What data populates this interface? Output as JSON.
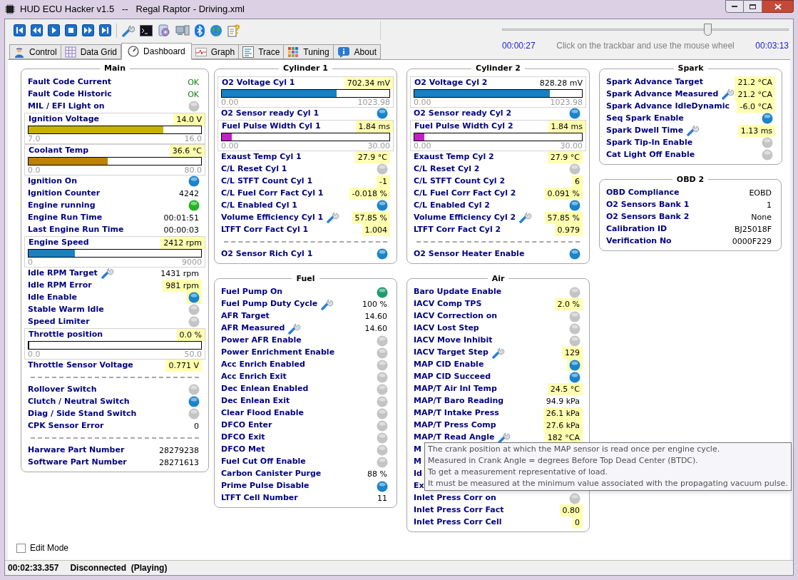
{
  "window": {
    "title": "HUD ECU Hacker v1.5   --   Regal Raptor - Driving.xml"
  },
  "playback": {
    "start": "00:00:27",
    "hint": "Click on the trackbar and use the mouse wheel",
    "end": "00:03:13",
    "level": 0.717
  },
  "tabs": [
    {
      "label": "Control",
      "selected": false
    },
    {
      "label": "Data Grid",
      "selected": false
    },
    {
      "label": "Dashboard",
      "selected": true
    },
    {
      "label": "Graph",
      "selected": false
    },
    {
      "label": "Trace",
      "selected": false
    },
    {
      "label": "Tuning",
      "selected": false
    },
    {
      "label": "About",
      "selected": false
    }
  ],
  "columns": [
    [
      {
        "title": "Main",
        "rows": [
          {
            "kind": "value",
            "label": "Fault Code Current",
            "value": "OK",
            "highlighted": false,
            "color": "#108010"
          },
          {
            "kind": "value",
            "label": "Fault Code Historic",
            "value": "OK",
            "highlighted": false,
            "color": "#108010"
          },
          {
            "kind": "led",
            "label": "MIL / EFI Light on",
            "color": "#c4c4c4",
            "highlighted": false
          },
          {
            "kind": "gauge",
            "label": "Ignition Voltage",
            "value": "14.0 V",
            "highlighted": true,
            "level": 0.78,
            "min": "7.0",
            "max": "16.0",
            "color": "#c8b000"
          },
          {
            "kind": "gauge",
            "label": "Coolant Temp",
            "value": "36.6 °C",
            "highlighted": true,
            "level": 0.46,
            "min": "0.0",
            "max": "80.0",
            "color": "#c08000"
          },
          {
            "kind": "led",
            "label": "Ignition On",
            "color": "#1a84c8",
            "highlighted": false
          },
          {
            "kind": "value",
            "label": "Ignition Counter",
            "value": "4242",
            "highlighted": false
          },
          {
            "kind": "led",
            "label": "Engine running",
            "color": "#22b422",
            "highlighted": false
          },
          {
            "kind": "value",
            "label": "Engine Run Time",
            "value": "00:01:51",
            "highlighted": false
          },
          {
            "kind": "value",
            "label": "Last Engine Run Time",
            "value": "00:00:03",
            "highlighted": false
          },
          {
            "kind": "gauge",
            "label": "Engine Speed",
            "value": "2412 rpm",
            "highlighted": true,
            "level": 0.27,
            "min": "0",
            "max": "9000",
            "color": "#1a80c0"
          },
          {
            "kind": "value",
            "label": "Idle RPM Target",
            "value": "1431 rpm",
            "highlighted": false,
            "wrench": true
          },
          {
            "kind": "value",
            "label": "Idle RPM Error",
            "value": "981 rpm",
            "highlighted": true
          },
          {
            "kind": "led",
            "label": "Idle Enable",
            "color": "#1a84c8",
            "highlighted": true
          },
          {
            "kind": "led",
            "label": "Stable Warm Idle",
            "color": "#c4c4c4",
            "highlighted": false
          },
          {
            "kind": "led",
            "label": "Speed Limiter",
            "color": "#c4c4c4",
            "highlighted": false
          },
          {
            "kind": "gauge",
            "label": "Throttle position",
            "value": "0.0 %",
            "highlighted": true,
            "level": 0,
            "min": "0.0",
            "max": "50.0"
          },
          {
            "kind": "value",
            "label": "Throttle Sensor Voltage",
            "value": "0.771 V",
            "highlighted": true
          },
          {
            "kind": "separator"
          },
          {
            "kind": "led",
            "label": "Rollover Switch",
            "color": "#c4c4c4",
            "highlighted": false
          },
          {
            "kind": "led",
            "label": "Clutch / Neutral Switch",
            "color": "#1a84c8",
            "highlighted": false
          },
          {
            "kind": "led",
            "label": "Diag / Side Stand Switch",
            "color": "#c4c4c4",
            "highlighted": false
          },
          {
            "kind": "value",
            "label": "CPK Sensor Error",
            "value": "0",
            "highlighted": false
          },
          {
            "kind": "separator"
          },
          {
            "kind": "value",
            "label": "Harware Part Number",
            "value": "28279238",
            "highlighted": false
          },
          {
            "kind": "value",
            "label": "Software Part Number",
            "value": "28271613",
            "highlighted": false
          }
        ]
      }
    ],
    [
      {
        "title": "Cylinder 1",
        "rows": [
          {
            "kind": "gauge",
            "label": "O2 Voltage Cyl 1",
            "value": "702.34 mV",
            "highlighted": true,
            "level": 0.686,
            "min": "0.00",
            "max": "1023.98",
            "color": "#1a80c0"
          },
          {
            "kind": "led",
            "label": "O2 Sensor ready Cyl 1",
            "color": "#1a84c8",
            "highlighted": false
          },
          {
            "kind": "gauge",
            "label": "Fuel Pulse Width Cyl 1",
            "value": "1.84 ms",
            "highlighted": true,
            "level": 0.06,
            "min": "0.00",
            "max": "30.00",
            "color": "#c020c0"
          },
          {
            "kind": "value",
            "label": "Exaust Temp Cyl 1",
            "value": "27.9 °C",
            "highlighted": true
          },
          {
            "kind": "led",
            "label": "C/L Reset Cyl 1",
            "color": "#c4c4c4",
            "highlighted": false
          },
          {
            "kind": "value",
            "label": "C/L STFT Count Cyl 1",
            "value": "-1",
            "highlighted": true
          },
          {
            "kind": "value",
            "label": "C/L Fuel Corr Fact Cyl 1",
            "value": "-0.018 %",
            "highlighted": true
          },
          {
            "kind": "led",
            "label": "C/L Enabled Cyl 1",
            "color": "#1a84c8",
            "highlighted": false
          },
          {
            "kind": "value",
            "label": "Volume Efficiency Cyl 1",
            "value": "57.85 %",
            "highlighted": true,
            "wrench": true
          },
          {
            "kind": "value",
            "label": "LTFT Corr Fact Cyl 1",
            "value": "1.004",
            "highlighted": true
          },
          {
            "kind": "separator"
          },
          {
            "kind": "led",
            "label": "O2 Sensor Rich Cyl 1",
            "color": "#1a84c8",
            "highlighted": false
          }
        ]
      },
      {
        "title": "Fuel",
        "rows": [
          {
            "kind": "led",
            "label": "Fuel Pump On",
            "color": "#1c9a70",
            "highlighted": false
          },
          {
            "kind": "value",
            "label": "Fuel Pump Duty Cycle",
            "value": "100 %",
            "highlighted": false,
            "wrench": true
          },
          {
            "kind": "value",
            "label": "AFR Target",
            "value": "14.60",
            "highlighted": false
          },
          {
            "kind": "value",
            "label": "AFR Measured",
            "value": "14.60",
            "highlighted": false,
            "wrench": true
          },
          {
            "kind": "led",
            "label": "Power AFR Enable",
            "color": "#c4c4c4",
            "highlighted": false
          },
          {
            "kind": "led",
            "label": "Power Enrichment Enable",
            "color": "#c4c4c4",
            "highlighted": false
          },
          {
            "kind": "led",
            "label": "Acc Enrich Enabled",
            "color": "#c4c4c4",
            "highlighted": false
          },
          {
            "kind": "led",
            "label": "Acc Enrich Exit",
            "color": "#c4c4c4",
            "highlighted": false
          },
          {
            "kind": "led",
            "label": "Dec Enlean Enabled",
            "color": "#c4c4c4",
            "highlighted": false
          },
          {
            "kind": "led",
            "label": "Dec Enlean Exit",
            "color": "#c4c4c4",
            "highlighted": false
          },
          {
            "kind": "led",
            "label": "Clear Flood Enable",
            "color": "#c4c4c4",
            "highlighted": false
          },
          {
            "kind": "led",
            "label": "DFCO Enter",
            "color": "#c4c4c4",
            "highlighted": false
          },
          {
            "kind": "led",
            "label": "DFCO Exit",
            "color": "#c4c4c4",
            "highlighted": false
          },
          {
            "kind": "led",
            "label": "DFCO Met",
            "color": "#c4c4c4",
            "highlighted": false
          },
          {
            "kind": "led",
            "label": "Fuel Cut Off Enable",
            "color": "#c4c4c4",
            "highlighted": false
          },
          {
            "kind": "value",
            "label": "Carbon Canister Purge",
            "value": "88 %",
            "highlighted": false
          },
          {
            "kind": "led",
            "label": "Prime Pulse Disable",
            "color": "#1a84c8",
            "highlighted": false
          },
          {
            "kind": "value",
            "label": "LTFT Cell Number",
            "value": "11",
            "highlighted": false
          }
        ]
      }
    ],
    [
      {
        "title": "Cylinder 2",
        "rows": [
          {
            "kind": "gauge",
            "label": "O2 Voltage Cyl 2",
            "value": "828.28 mV",
            "highlighted": false,
            "level": 0.81,
            "min": "0.00",
            "max": "1023.98",
            "color": "#1a80c0"
          },
          {
            "kind": "led",
            "label": "O2 Sensor ready Cyl 2",
            "color": "#1a84c8",
            "highlighted": false
          },
          {
            "kind": "gauge",
            "label": "Fuel Pulse Width Cyl 2",
            "value": "1.84 ms",
            "highlighted": true,
            "level": 0.06,
            "min": "0.00",
            "max": "30.00",
            "color": "#c020c0"
          },
          {
            "kind": "value",
            "label": "Exaust Temp Cyl 2",
            "value": "27.9 °C",
            "highlighted": true
          },
          {
            "kind": "led",
            "label": "C/L Reset Cyl 2",
            "color": "#c4c4c4",
            "highlighted": false
          },
          {
            "kind": "value",
            "label": "C/L STFT Count Cyl 2",
            "value": "6",
            "highlighted": true
          },
          {
            "kind": "value",
            "label": "C/L Fuel Corr Fact Cyl 2",
            "value": "0.091 %",
            "highlighted": true
          },
          {
            "kind": "led",
            "label": "C/L Enabled Cyl 2",
            "color": "#1a84c8",
            "highlighted": false
          },
          {
            "kind": "value",
            "label": "Volume Efficiency Cyl 2",
            "value": "57.85 %",
            "highlighted": true,
            "wrench": true
          },
          {
            "kind": "value",
            "label": "LTFT Corr Fact Cyl 2",
            "value": "0.979",
            "highlighted": true
          },
          {
            "kind": "separator"
          },
          {
            "kind": "led",
            "label": "O2 Sensor Heater Enable",
            "color": "#1a84c8",
            "highlighted": false
          }
        ]
      },
      {
        "title": "Air",
        "rows": [
          {
            "kind": "led",
            "label": "Baro Update Enable",
            "color": "#c4c4c4",
            "highlighted": false
          },
          {
            "kind": "value",
            "label": "IACV Comp TPS",
            "value": "2.0 %",
            "highlighted": true
          },
          {
            "kind": "led",
            "label": "IACV Correction on",
            "color": "#c4c4c4",
            "highlighted": false
          },
          {
            "kind": "led",
            "label": "IACV Lost Step",
            "color": "#c4c4c4",
            "highlighted": false
          },
          {
            "kind": "led",
            "label": "IACV Move Inhibit",
            "color": "#c4c4c4",
            "highlighted": false
          },
          {
            "kind": "value",
            "label": "IACV Target Step",
            "value": "129",
            "highlighted": true,
            "wrench": true
          },
          {
            "kind": "led",
            "label": "MAP CID Enable",
            "color": "#1a84c8",
            "highlighted": true
          },
          {
            "kind": "led",
            "label": "MAP CID Succeed",
            "color": "#1a84c8",
            "highlighted": false
          },
          {
            "kind": "value",
            "label": "MAP/T Air Inl Temp",
            "value": "24.5 °C",
            "highlighted": true
          },
          {
            "kind": "value",
            "label": "MAP/T Baro Reading",
            "value": "94.9 kPa",
            "highlighted": false
          },
          {
            "kind": "value",
            "label": "MAP/T Intake Press",
            "value": "26.1 kPa",
            "highlighted": true
          },
          {
            "kind": "value",
            "label": "MAP/T Press Comp",
            "value": "27.6 kPa",
            "highlighted": true
          },
          {
            "kind": "value",
            "label": "MAP/T Read Angle",
            "value": "182 °CA",
            "highlighted": true,
            "wrench": true
          },
          {
            "kind": "value",
            "label": "M"
          },
          {
            "kind": "value",
            "label": "M"
          },
          {
            "kind": "value",
            "label": "Id"
          },
          {
            "kind": "value",
            "label": "Ex"
          },
          {
            "kind": "led",
            "label": "Inlet Press Corr on",
            "color": "#c4c4c4",
            "highlighted": false
          },
          {
            "kind": "value",
            "label": "Inlet Press Corr Fact",
            "value": "0.80",
            "highlighted": true
          },
          {
            "kind": "value",
            "label": "Inlet Press Corr Cell",
            "value": "0",
            "highlighted": true
          }
        ]
      }
    ],
    [
      {
        "title": "Spark",
        "rows": [
          {
            "kind": "value",
            "label": "Spark Advance Target",
            "value": "21.2 °CA",
            "highlighted": true
          },
          {
            "kind": "value",
            "label": "Spark Advance Measured",
            "value": "21.2 °CA",
            "highlighted": true,
            "wrench": true
          },
          {
            "kind": "value",
            "label": "Spark Advance IdleDynamic",
            "value": "-6.0 °CA",
            "highlighted": true
          },
          {
            "kind": "led",
            "label": "Seq Spark Enable",
            "color": "#1a84c8",
            "highlighted": false
          },
          {
            "kind": "value",
            "label": "Spark Dwell Time",
            "value": "1.13 ms",
            "highlighted": true,
            "wrench": true
          },
          {
            "kind": "led",
            "label": "Spark Tip-In Enable",
            "color": "#c4c4c4",
            "highlighted": false
          },
          {
            "kind": "led",
            "label": "Cat Light Off Enable",
            "color": "#c4c4c4",
            "highlighted": false
          }
        ]
      },
      {
        "title": "OBD 2",
        "rows": [
          {
            "kind": "value",
            "label": "OBD Compliance",
            "value": "EOBD",
            "highlighted": false
          },
          {
            "kind": "value",
            "label": "O2 Sensors Bank 1",
            "value": "1",
            "highlighted": false
          },
          {
            "kind": "value",
            "label": "O2 Sensors Bank 2",
            "value": "None",
            "highlighted": false
          },
          {
            "kind": "value",
            "label": "Calibration ID",
            "value": "BJ25018F",
            "highlighted": false
          },
          {
            "kind": "value",
            "label": "Verification No",
            "value": "0000F229",
            "highlighted": false
          }
        ]
      }
    ]
  ],
  "tooltip": {
    "lines": [
      "The crank position at which the MAP sensor is read once per engine cycle.",
      "Measured in Crank Angle = degrees Before Top Dead Center (BTDC).",
      "To get a measurement representative of load.",
      "It must be measured at the minimum value associated with the propagating vacuum pulse."
    ]
  },
  "edit_mode": {
    "label": "Edit Mode",
    "checked": false
  },
  "status_bar": {
    "time": "00:02:33.357",
    "status": "Disconnected  (Playing)"
  }
}
